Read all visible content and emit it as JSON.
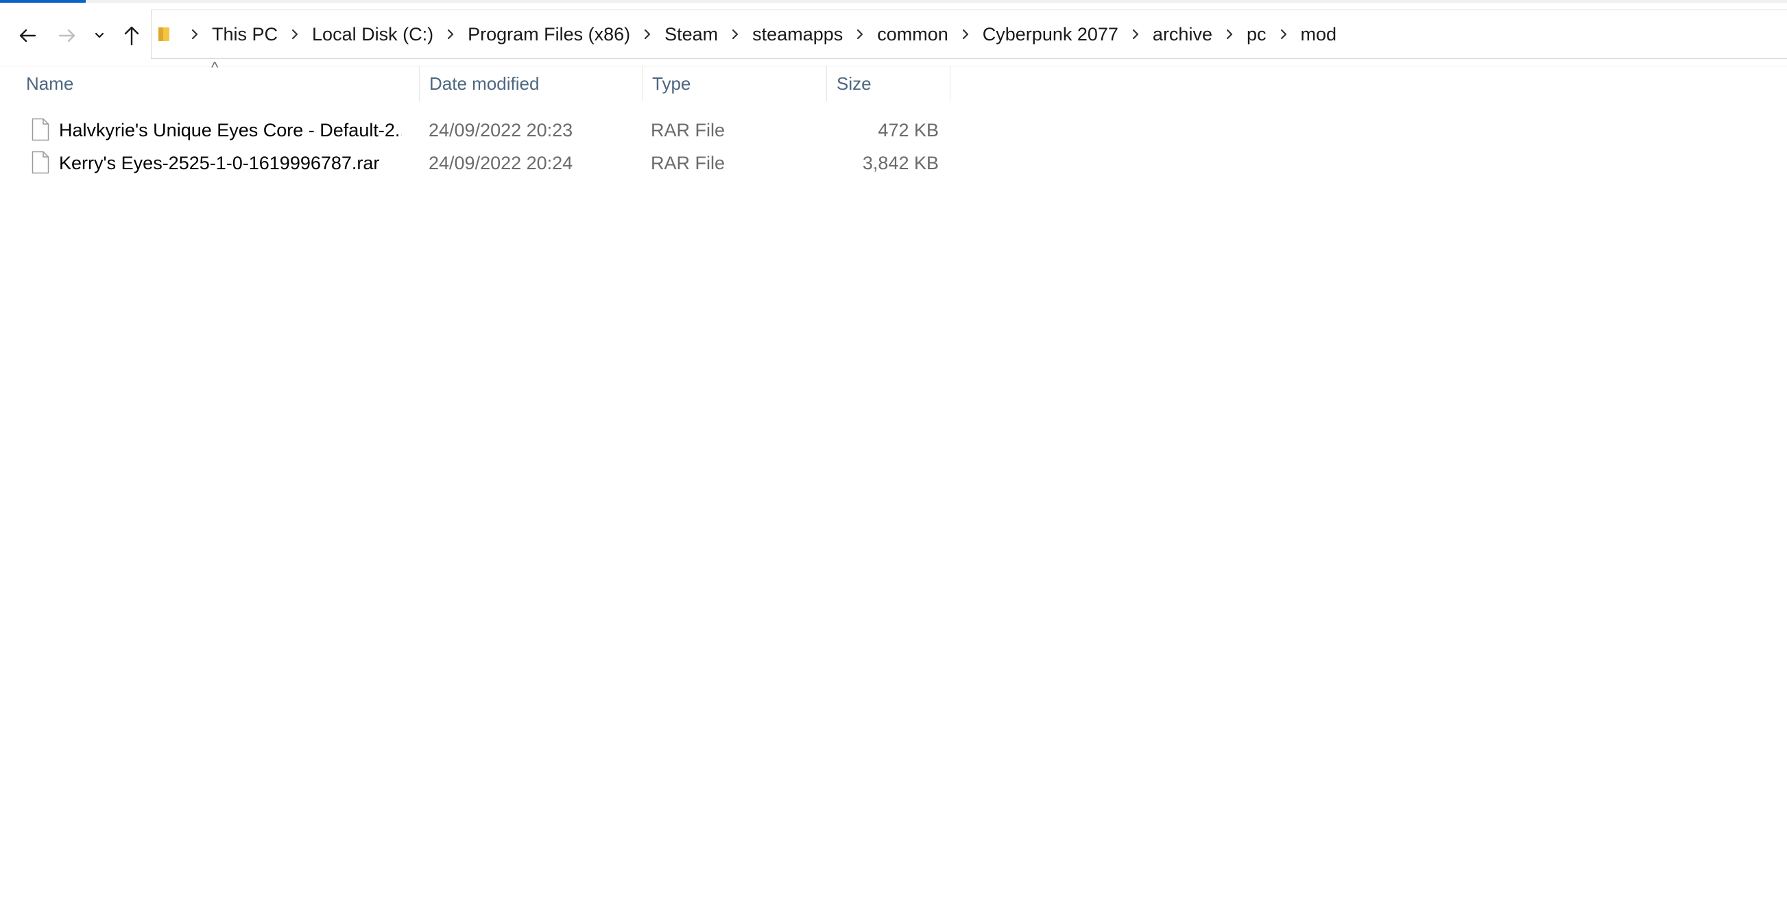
{
  "progress": {
    "fraction": 0.048
  },
  "navigation": {
    "back_icon": "arrow-left-icon",
    "forward_icon": "arrow-right-icon",
    "recent_icon": "chevron-down-icon",
    "up_icon": "arrow-up-icon"
  },
  "address_bar": {
    "folder_icon": "folder-icon",
    "breadcrumbs": [
      "This PC",
      "Local Disk (C:)",
      "Program Files (x86)",
      "Steam",
      "steamapps",
      "common",
      "Cyberpunk 2077",
      "archive",
      "pc",
      "mod"
    ]
  },
  "columns": {
    "name": "Name",
    "date_modified": "Date modified",
    "type": "Type",
    "size": "Size",
    "sort_indicator": "^"
  },
  "files": [
    {
      "name": "Halvkyrie's Unique Eyes Core - Default-2...",
      "date_modified": "24/09/2022 20:23",
      "type": "RAR File",
      "size": "472 KB",
      "icon": "file-icon"
    },
    {
      "name": "Kerry's Eyes-2525-1-0-1619996787.rar",
      "date_modified": "24/09/2022 20:24",
      "type": "RAR File",
      "size": "3,842 KB",
      "icon": "file-icon"
    }
  ],
  "colors": {
    "accent": "#0a64c8",
    "header_text": "#4d6680",
    "secondary_text": "#6b6b6b"
  }
}
